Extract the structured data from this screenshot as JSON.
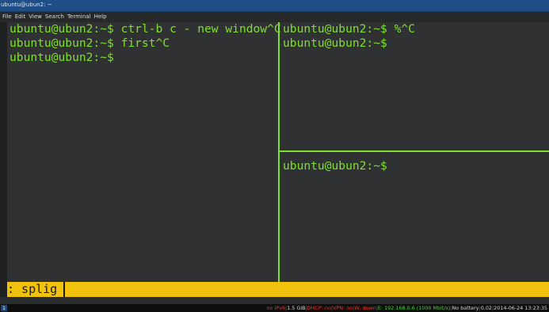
{
  "window": {
    "title": "ubuntu@ubun2: ~"
  },
  "menu": {
    "items": [
      "File",
      "Edit",
      "View",
      "Search",
      "Terminal",
      "Help"
    ]
  },
  "panes": {
    "left": {
      "lines": [
        "ubuntu@ubun2:~$ ctrl-b c - new window^C",
        "ubuntu@ubun2:~$ first^C",
        "ubuntu@ubun2:~$"
      ]
    },
    "top_right": {
      "lines": [
        "ubuntu@ubun2:~$ %^C",
        "ubuntu@ubun2:~$"
      ]
    },
    "bottom_right": {
      "lines": [
        "ubuntu@ubun2:~$"
      ]
    }
  },
  "tmux_command": {
    "text": ": splig"
  },
  "statusbar": {
    "workspace": "1",
    "ipv6": "no IPv6",
    "memory": "1.5 GiB",
    "dhcp": "DHCP: no",
    "vpn": "VPN: no",
    "wifi": "W: down",
    "ethernet": "E: 192.168.0.6 (1000 Mbit/s)",
    "battery": "No battery",
    "load": "0.02",
    "datetime": "2014-06-24 13:23:35"
  },
  "colors": {
    "terminal_fg": "#7ee02c",
    "command_bar_bg": "#f0c20c",
    "titlebar_bg": "#1f4f86",
    "status_red": "#e23a2c",
    "status_green": "#46d03a"
  }
}
